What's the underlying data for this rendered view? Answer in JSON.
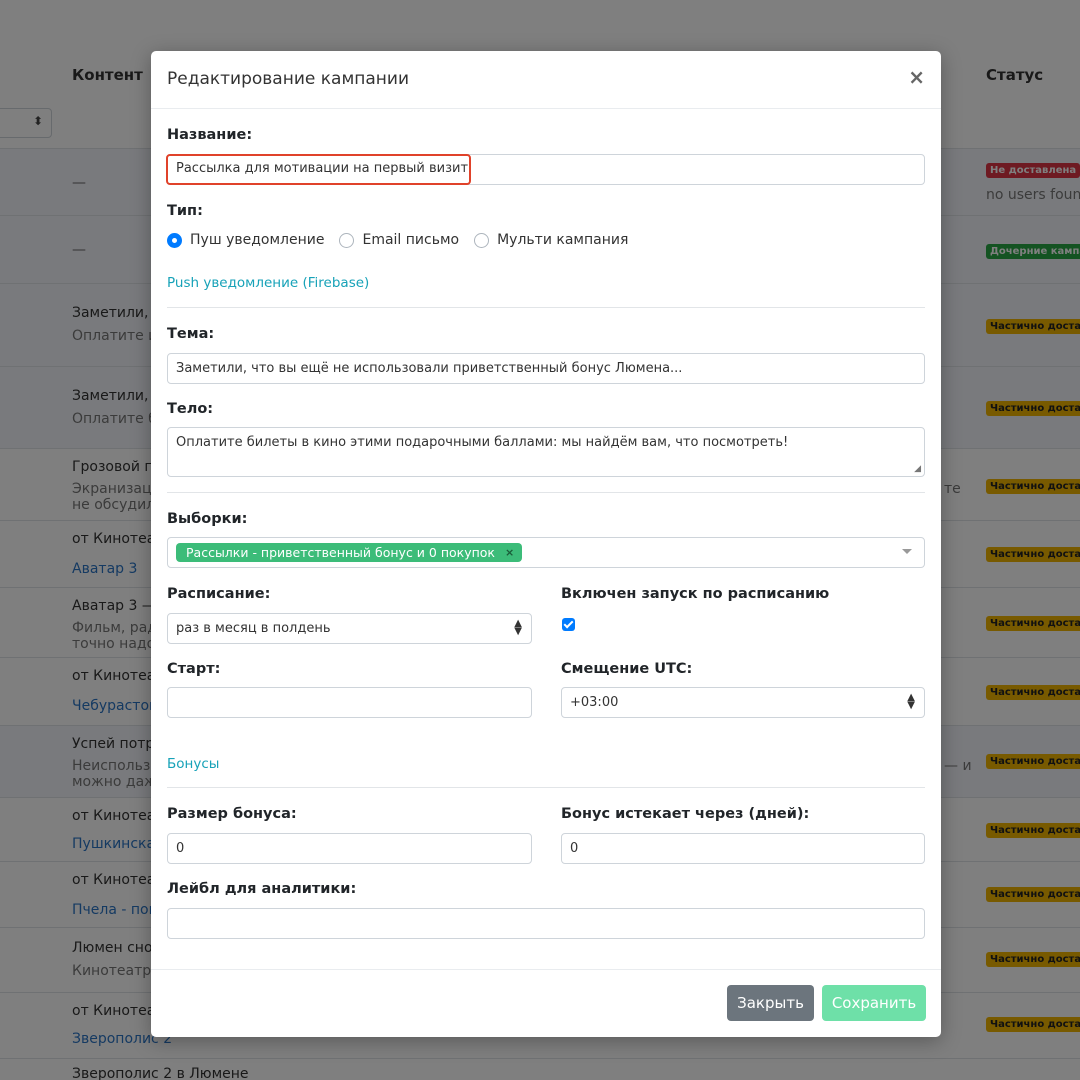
{
  "background": {
    "headers": {
      "content": "Контент",
      "status": "Статус"
    },
    "select_arrows": "⬍",
    "rows": [
      {
        "line1": "—",
        "badge": "Не доставлена",
        "badge_color": "red",
        "note": "no users found"
      },
      {
        "line1": "—",
        "badge": "Дочерние кампании",
        "badge_color": "green"
      },
      {
        "line1": "Заметили, ч",
        "line2": "Оплатите и",
        "badge": "Частично доставлена",
        "badge_color": "yellow"
      },
      {
        "line1": "Заметили, ч",
        "line2": "Оплатите б",
        "badge": "Частично доставлена",
        "badge_color": "yellow"
      },
      {
        "line1": "Грозовой пе",
        "line2": "Экранизац",
        "line3": "не обсудил",
        "side": "те",
        "badge": "Частично доставлена",
        "badge_color": "yellow"
      },
      {
        "line1": "от Кинотеа",
        "link": "Аватар 3",
        "badge": "Частично доставлена",
        "badge_color": "yellow"
      },
      {
        "line1": "Аватар 3 —",
        "line2": "Фильм, рад",
        "line3": "точно надо",
        "badge": "Частично доставлена",
        "badge_color": "yellow"
      },
      {
        "line1": "от Кинотеа",
        "link": "Чебурасток",
        "badge": "Частично доставлена",
        "badge_color": "yellow"
      },
      {
        "line1": "Успей потра",
        "line2": "Неиспользо",
        "line3": "можно даж",
        "side": "— и",
        "badge": "Частично доставлена",
        "badge_color": "yellow"
      },
      {
        "line1": "от Кинотеа",
        "link": "Пушкинска",
        "badge": "Частично доставлена",
        "badge_color": "yellow"
      },
      {
        "line1": "от Кинотеа",
        "link": "Пчела - пои",
        "badge": "Частично доставлена",
        "badge_color": "yellow"
      },
      {
        "line1": "Люмен сно",
        "line2": "Кинотеатр",
        "badge": "Частично доставлена",
        "badge_color": "yellow"
      },
      {
        "line1": "от Кинотеа",
        "link": "Зверополис 2",
        "badge": "Частично доставлена",
        "badge_color": "yellow"
      },
      {
        "line1": "Зверополис 2 в Люмене"
      }
    ]
  },
  "modal": {
    "title": "Редактирование кампании",
    "close_icon": "×",
    "name": {
      "label": "Название:",
      "value": "Рассылка для мотивации на первый визит"
    },
    "type": {
      "label": "Тип:",
      "options": [
        {
          "label": "Пуш уведомление",
          "selected": true
        },
        {
          "label": "Email письмо",
          "selected": false
        },
        {
          "label": "Мульти кампания",
          "selected": false
        }
      ]
    },
    "section_push": "Push уведомление (Firebase)",
    "subject": {
      "label": "Тема:",
      "value": "Заметили, что вы ещё не использовали приветственный бонус Люмена..."
    },
    "body": {
      "label": "Тело:",
      "value": "Оплатите билеты в кино этими подарочными баллами: мы найдём вам, что посмотреть!"
    },
    "segments": {
      "label": "Выборки:",
      "tag": "Рассылки - приветственный бонус и 0 покупок",
      "tag_remove": "×"
    },
    "schedule": {
      "label": "Расписание:",
      "value": "раз в месяц в полдень"
    },
    "schedule_enabled": {
      "label": "Включен запуск по расписанию",
      "checked": true
    },
    "start": {
      "label": "Старт:",
      "value": ""
    },
    "utc_offset": {
      "label": "Смещение UTC:",
      "value": "+03:00"
    },
    "section_bonus": "Бонусы",
    "bonus_size": {
      "label": "Размер бонуса:",
      "value": "0"
    },
    "bonus_expires": {
      "label": "Бонус истекает через (дней):",
      "value": "0"
    },
    "analytics_label": {
      "label": "Лейбл для аналитики:",
      "value": ""
    },
    "buttons": {
      "close": "Закрыть",
      "save": "Сохранить"
    }
  },
  "colors": {
    "highlight": "#e0422a",
    "primary": "#007bff",
    "tag": "#3cbc79",
    "save": "#6ee0a8",
    "close": "#6c757d",
    "link": "#17a2b8"
  }
}
